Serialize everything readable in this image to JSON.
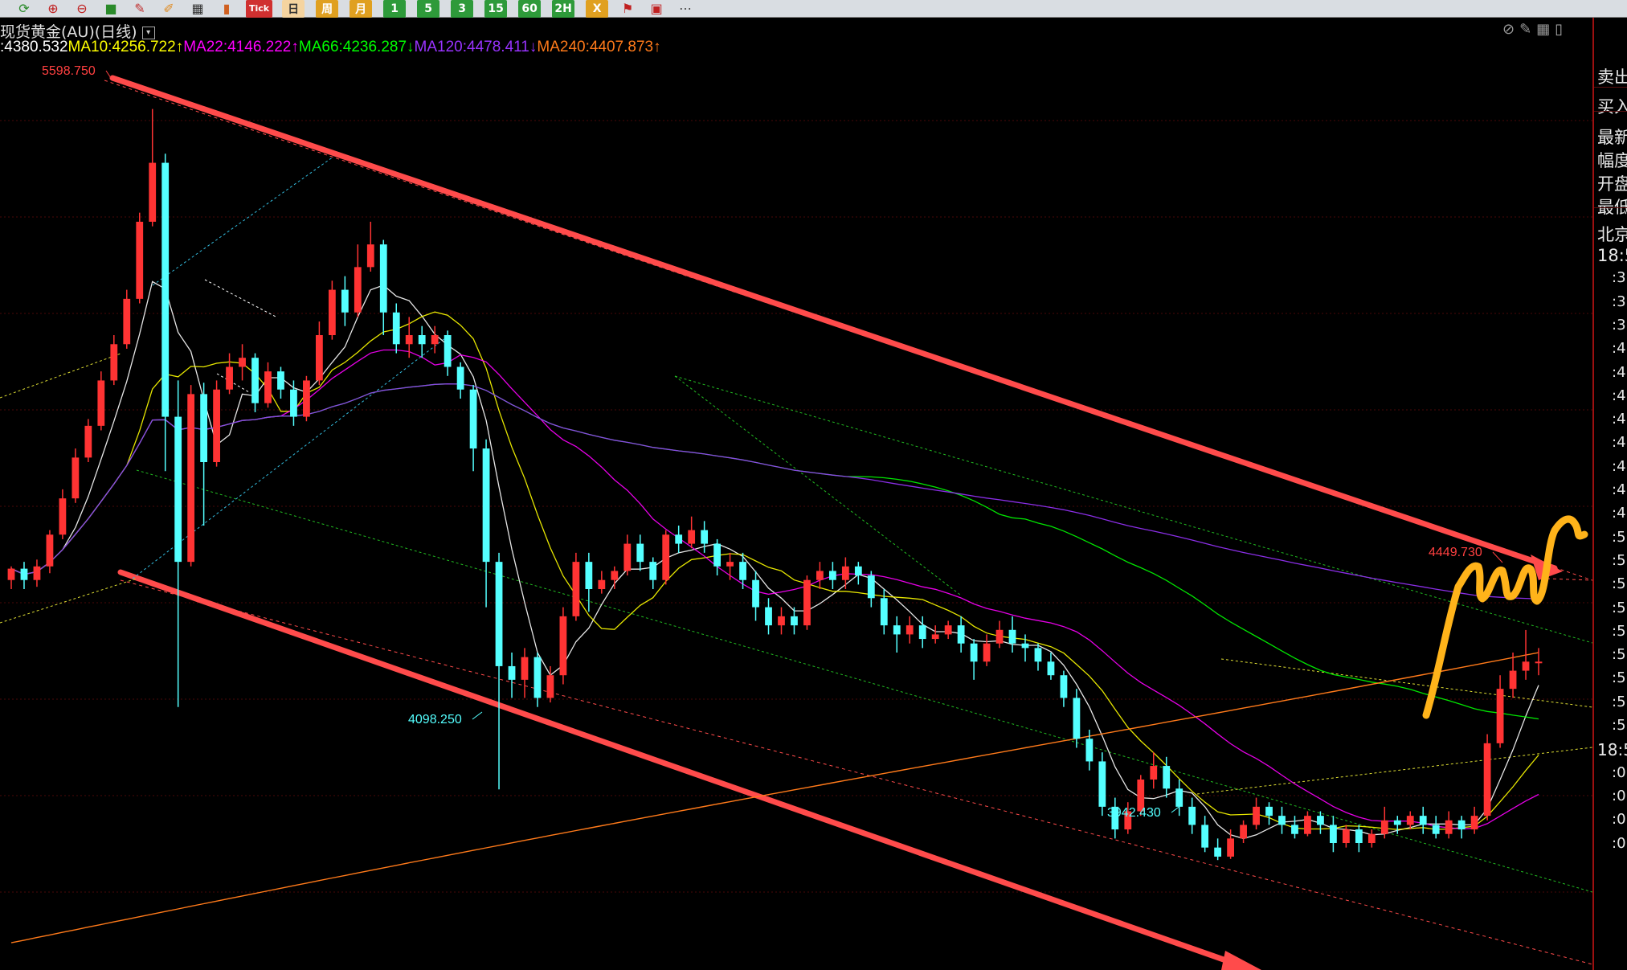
{
  "toolbar": {
    "period_buttons": [
      {
        "label": "日",
        "bg": "#f5d4a0",
        "fg": "#333"
      },
      {
        "label": "周",
        "bg": "#e0a020",
        "fg": "#fff"
      },
      {
        "label": "月",
        "bg": "#e0a020",
        "fg": "#fff"
      },
      {
        "label": "1",
        "bg": "#2e9a3a",
        "fg": "#fff"
      },
      {
        "label": "5",
        "bg": "#2e9a3a",
        "fg": "#fff"
      },
      {
        "label": "3",
        "bg": "#2e9a3a",
        "fg": "#fff"
      },
      {
        "label": "15",
        "bg": "#2e9a3a",
        "fg": "#fff"
      },
      {
        "label": "60",
        "bg": "#2e9a3a",
        "fg": "#fff"
      },
      {
        "label": "2H",
        "bg": "#2e9a3a",
        "fg": "#fff"
      },
      {
        "label": "X",
        "bg": "#e0a020",
        "fg": "#fff"
      }
    ],
    "tick_label": "Tick"
  },
  "header": {
    "title": "现货黄金(AU)(日线)",
    "ma_items": [
      {
        "label": ":4380.532",
        "color": "#ffffff"
      },
      {
        "label": "MA10:4256.722↑",
        "color": "#ffff00"
      },
      {
        "label": "MA22:4146.222↑",
        "color": "#ff00ff"
      },
      {
        "label": "MA66:4236.287↓",
        "color": "#00ff00"
      },
      {
        "label": "MA120:4478.411↓",
        "color": "#9933ff"
      },
      {
        "label": "MA240:4407.873↑",
        "color": "#ff7a1a"
      }
    ]
  },
  "right_panel": {
    "items": [
      "卖出",
      "买入",
      "最新",
      "幅度",
      "开盘",
      "最低",
      "北京",
      "18:5",
      ":3",
      ":3",
      ":3",
      ":4",
      ":4",
      ":4",
      ":4",
      ":4",
      ":4",
      ":4",
      ":4",
      ":5",
      ":5",
      ":5",
      ":5",
      ":5",
      ":5",
      ":5",
      ":5",
      ":5",
      "18:5",
      ":0",
      ":0",
      ":0",
      ":0"
    ]
  },
  "chart_data": {
    "type": "candlestick",
    "ylim": [
      3700,
      5800
    ],
    "up_color": "#ff3333",
    "down_color": "#54ffff",
    "annotations": [
      {
        "text": "5598.750",
        "value": 5598.75,
        "color": "#ff4040"
      },
      {
        "text": "4098.250",
        "value": 4098.25,
        "color": "#54ffff"
      },
      {
        "text": "3942.430",
        "value": 3942.43,
        "color": "#54ffff"
      },
      {
        "text": "4449.730",
        "value": 4449.73,
        "color": "#ff4040"
      }
    ],
    "candles": [
      [
        4560,
        4585,
        4540,
        4590
      ],
      [
        4585,
        4560,
        4540,
        4600
      ],
      [
        4560,
        4590,
        4545,
        4605
      ],
      [
        4590,
        4660,
        4575,
        4670
      ],
      [
        4660,
        4740,
        4650,
        4760
      ],
      [
        4740,
        4830,
        4730,
        4850
      ],
      [
        4830,
        4900,
        4820,
        4915
      ],
      [
        4900,
        5000,
        4890,
        5020
      ],
      [
        5000,
        5080,
        4990,
        5100
      ],
      [
        5080,
        5180,
        5070,
        5200
      ],
      [
        5180,
        5350,
        5170,
        5370
      ],
      [
        5350,
        5480,
        5340,
        5598.75
      ],
      [
        5480,
        4920,
        4800,
        5500
      ],
      [
        4920,
        4600,
        4280,
        5000
      ],
      [
        4600,
        4970,
        4590,
        4990
      ],
      [
        4970,
        4820,
        4680,
        4995
      ],
      [
        4820,
        4980,
        4810,
        5000
      ],
      [
        4980,
        5030,
        4970,
        5060
      ],
      [
        5030,
        5050,
        5000,
        5080
      ],
      [
        5050,
        4950,
        4930,
        5060
      ],
      [
        4950,
        5020,
        4940,
        5040
      ],
      [
        5020,
        4980,
        4960,
        5030
      ],
      [
        4980,
        4920,
        4900,
        5000
      ],
      [
        4920,
        5000,
        4910,
        5010
      ],
      [
        5000,
        5100,
        4990,
        5130
      ],
      [
        5100,
        5200,
        5090,
        5220
      ],
      [
        5200,
        5150,
        5120,
        5230
      ],
      [
        5150,
        5250,
        5140,
        5300
      ],
      [
        5250,
        5300,
        5240,
        5350
      ],
      [
        5300,
        5150,
        5100,
        5310
      ],
      [
        5150,
        5080,
        5060,
        5170
      ],
      [
        5080,
        5100,
        5050,
        5140
      ],
      [
        5100,
        5080,
        5050,
        5120
      ],
      [
        5080,
        5100,
        5060,
        5120
      ],
      [
        5100,
        5030,
        5010,
        5110
      ],
      [
        5030,
        4980,
        4960,
        5040
      ],
      [
        4980,
        4850,
        4800,
        4990
      ],
      [
        4850,
        4600,
        4500,
        4870
      ],
      [
        4600,
        4370,
        4098.25,
        4620
      ],
      [
        4370,
        4340,
        4300,
        4400
      ],
      [
        4340,
        4390,
        4300,
        4410
      ],
      [
        4390,
        4300,
        4280,
        4400
      ],
      [
        4300,
        4350,
        4290,
        4370
      ],
      [
        4350,
        4480,
        4330,
        4500
      ],
      [
        4480,
        4600,
        4470,
        4620
      ],
      [
        4600,
        4540,
        4490,
        4620
      ],
      [
        4540,
        4560,
        4530,
        4580
      ],
      [
        4560,
        4580,
        4540,
        4590
      ],
      [
        4580,
        4640,
        4570,
        4660
      ],
      [
        4640,
        4600,
        4580,
        4660
      ],
      [
        4600,
        4560,
        4540,
        4610
      ],
      [
        4560,
        4660,
        4550,
        4670
      ],
      [
        4660,
        4640,
        4620,
        4680
      ],
      [
        4640,
        4670,
        4630,
        4700
      ],
      [
        4670,
        4640,
        4620,
        4690
      ],
      [
        4640,
        4590,
        4570,
        4650
      ],
      [
        4590,
        4600,
        4560,
        4620
      ],
      [
        4600,
        4560,
        4540,
        4620
      ],
      [
        4560,
        4500,
        4470,
        4580
      ],
      [
        4500,
        4460,
        4440,
        4520
      ],
      [
        4460,
        4480,
        4440,
        4500
      ],
      [
        4480,
        4460,
        4440,
        4500
      ],
      [
        4460,
        4560,
        4450,
        4570
      ],
      [
        4560,
        4580,
        4540,
        4600
      ],
      [
        4580,
        4560,
        4540,
        4600
      ],
      [
        4560,
        4590,
        4540,
        4610
      ],
      [
        4590,
        4570,
        4550,
        4600
      ],
      [
        4570,
        4520,
        4500,
        4580
      ],
      [
        4520,
        4460,
        4440,
        4540
      ],
      [
        4460,
        4440,
        4400,
        4480
      ],
      [
        4440,
        4460,
        4420,
        4480
      ],
      [
        4460,
        4430,
        4410,
        4480
      ],
      [
        4430,
        4440,
        4420,
        4460
      ],
      [
        4440,
        4460,
        4430,
        4470
      ],
      [
        4460,
        4420,
        4400,
        4480
      ],
      [
        4420,
        4380,
        4340,
        4430
      ],
      [
        4380,
        4420,
        4370,
        4440
      ],
      [
        4420,
        4450,
        4410,
        4470
      ],
      [
        4450,
        4420,
        4400,
        4480
      ],
      [
        4420,
        4410,
        4380,
        4440
      ],
      [
        4410,
        4380,
        4360,
        4420
      ],
      [
        4380,
        4350,
        4340,
        4400
      ],
      [
        4350,
        4300,
        4280,
        4360
      ],
      [
        4300,
        4210,
        4190,
        4320
      ],
      [
        4210,
        4160,
        4140,
        4230
      ],
      [
        4160,
        4060,
        4040,
        4180
      ],
      [
        4060,
        4010,
        3990,
        4080
      ],
      [
        4010,
        4050,
        4000,
        4070
      ],
      [
        4050,
        4120,
        4040,
        4130
      ],
      [
        4120,
        4150,
        4100,
        4180
      ],
      [
        4150,
        4100,
        4080,
        4170
      ],
      [
        4100,
        4060,
        4040,
        4120
      ],
      [
        4060,
        4020,
        4000,
        4080
      ],
      [
        4020,
        3970,
        3960,
        4040
      ],
      [
        3970,
        3950,
        3942.43,
        3990
      ],
      [
        3950,
        3990,
        3945,
        4010
      ],
      [
        3990,
        4020,
        3980,
        4030
      ],
      [
        4020,
        4060,
        4010,
        4080
      ],
      [
        4060,
        4040,
        4020,
        4070
      ],
      [
        4040,
        4020,
        4000,
        4060
      ],
      [
        4020,
        4000,
        3990,
        4040
      ],
      [
        4000,
        4040,
        3995,
        4050
      ],
      [
        4040,
        4020,
        4000,
        4050
      ],
      [
        4020,
        3980,
        3960,
        4040
      ],
      [
        3980,
        4010,
        3970,
        4020
      ],
      [
        4010,
        3980,
        3960,
        4020
      ],
      [
        3980,
        4000,
        3970,
        4010
      ],
      [
        4000,
        4030,
        3990,
        4060
      ],
      [
        4030,
        4020,
        4000,
        4040
      ],
      [
        4020,
        4040,
        4010,
        4050
      ],
      [
        4040,
        4020,
        4000,
        4060
      ],
      [
        4020,
        4000,
        3990,
        4040
      ],
      [
        4000,
        4030,
        3990,
        4050
      ],
      [
        4030,
        4010,
        3990,
        4040
      ],
      [
        4010,
        4040,
        4000,
        4060
      ],
      [
        4040,
        4200,
        4030,
        4220
      ],
      [
        4200,
        4320,
        4190,
        4350
      ],
      [
        4320,
        4360,
        4300,
        4400
      ],
      [
        4360,
        4380,
        4340,
        4449.73
      ],
      [
        4380,
        4380,
        4350,
        4410
      ]
    ]
  }
}
